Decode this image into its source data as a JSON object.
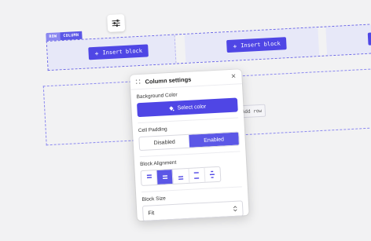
{
  "toolbar": {
    "settings_icon": "sliders-icon"
  },
  "row": {
    "tags": {
      "row": "ROW",
      "column": "COLUMN"
    },
    "insert_label": "Insert block"
  },
  "add_row_label": "Add row",
  "panel": {
    "title": "Column settings",
    "background_color": {
      "label": "Background Color",
      "button": "Select color"
    },
    "cell_padding": {
      "label": "Cell Padding",
      "options": [
        "Disabled",
        "Enabled"
      ],
      "selected": "Enabled"
    },
    "block_alignment": {
      "label": "Block Alignment",
      "selected_index": 1
    },
    "block_size": {
      "label": "Block Size",
      "value": "Fit"
    }
  },
  "colors": {
    "accent": "#4f46e5",
    "accent_light": "#5b57e6",
    "cell_bg": "#e7e8f8"
  }
}
